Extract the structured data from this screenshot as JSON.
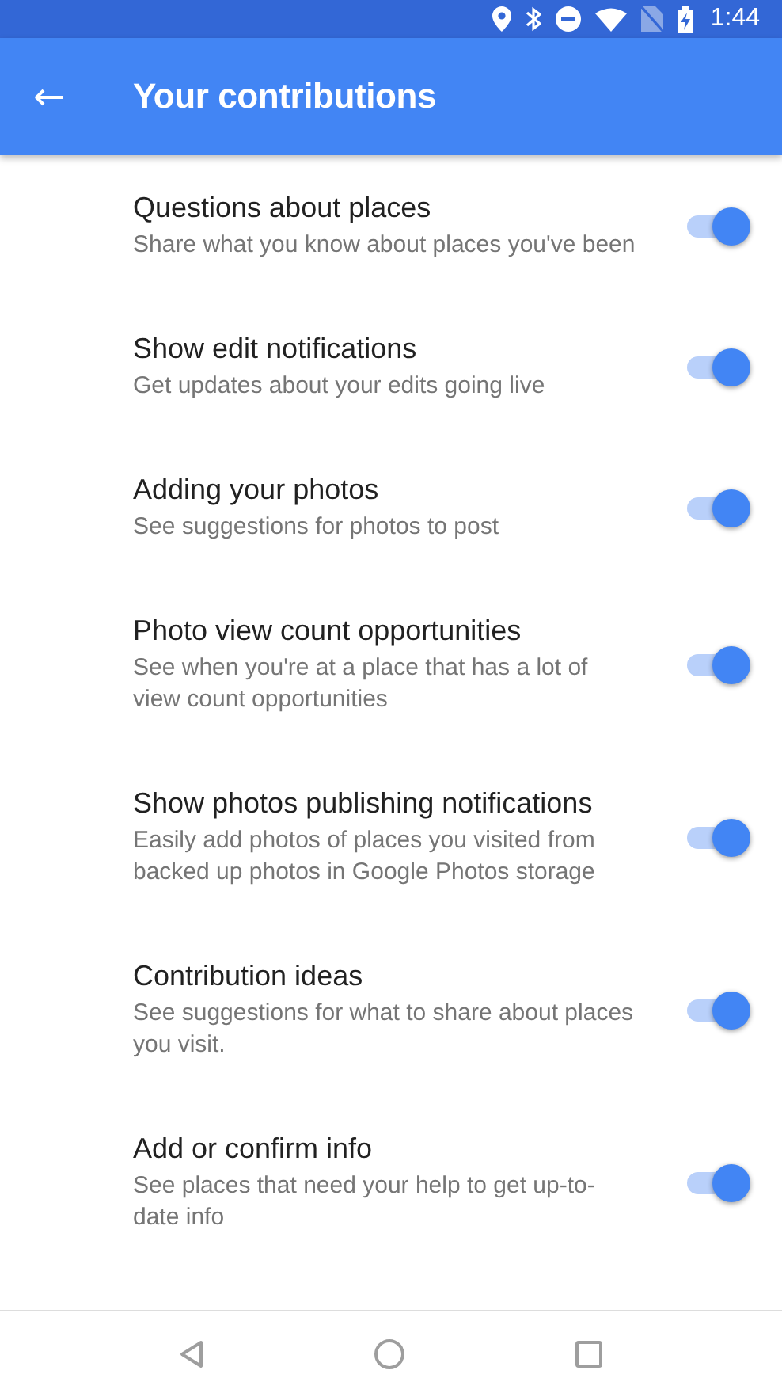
{
  "status_bar": {
    "time": "1:44"
  },
  "app_bar": {
    "back": "←",
    "title": "Your contributions"
  },
  "settings": [
    {
      "title": "Questions about places",
      "description": "Share what you know about places you've been",
      "on": true
    },
    {
      "title": "Show edit notifications",
      "description": "Get updates about your edits going live",
      "on": true
    },
    {
      "title": "Adding your photos",
      "description": "See suggestions for photos to post",
      "on": true
    },
    {
      "title": "Photo view count opportunities",
      "description": "See when you're at a place that has a lot of view count opportunities",
      "on": true
    },
    {
      "title": "Show photos publishing notifications",
      "description": "Easily add photos of places you visited from backed up photos in Google Photos storage",
      "on": true
    },
    {
      "title": "Contribution ideas",
      "description": "See suggestions for what to share about places you visit.",
      "on": true
    },
    {
      "title": "Add or confirm info",
      "description": "See places that need your help to get up-to-date info",
      "on": true
    }
  ]
}
